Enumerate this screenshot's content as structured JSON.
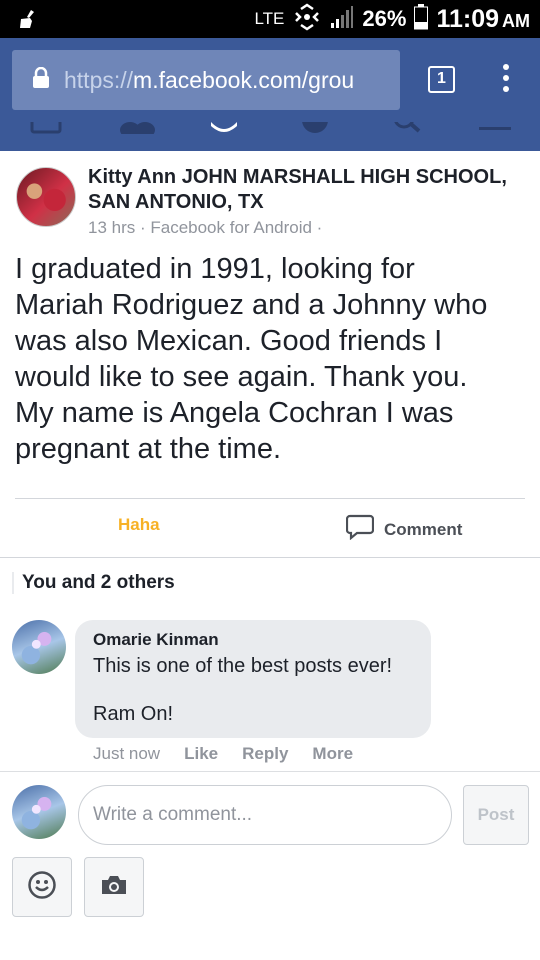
{
  "status_bar": {
    "network": "LTE",
    "battery": "26%",
    "time": "11:09",
    "ampm": "AM"
  },
  "browser": {
    "url_protocol": "https://",
    "url_host": "m.facebook.com/grou",
    "tab_count": "1"
  },
  "post": {
    "author_line1": "Kitty Ann JOHN MARSHALL HIGH SCHOOL,",
    "author_line2": "SAN ANTONIO, TX",
    "meta": "13 hrs · Facebook for Android ·",
    "body_lines": [
      "I graduated in 1991, looking for",
      "Mariah Rodriguez and a Johnny who",
      "was also Mexican. Good friends I",
      "would like to see again. Thank you.",
      "My name is Angela Cochran I was",
      "pregnant at the time."
    ]
  },
  "reactions": {
    "haha_label": "Haha",
    "comment_label": "Comment",
    "summary": "You and 2 others"
  },
  "comment": {
    "author": "Omarie Kinman",
    "line1": "This is one of the best posts ever!",
    "line2": "Ram On!",
    "timestamp": "Just now",
    "like": "Like",
    "reply": "Reply",
    "more": "More"
  },
  "composer": {
    "placeholder": "Write a comment...",
    "post_label": "Post"
  },
  "colors": {
    "facebook_blue": "#3b5998",
    "haha_yellow": "#f7b125"
  }
}
